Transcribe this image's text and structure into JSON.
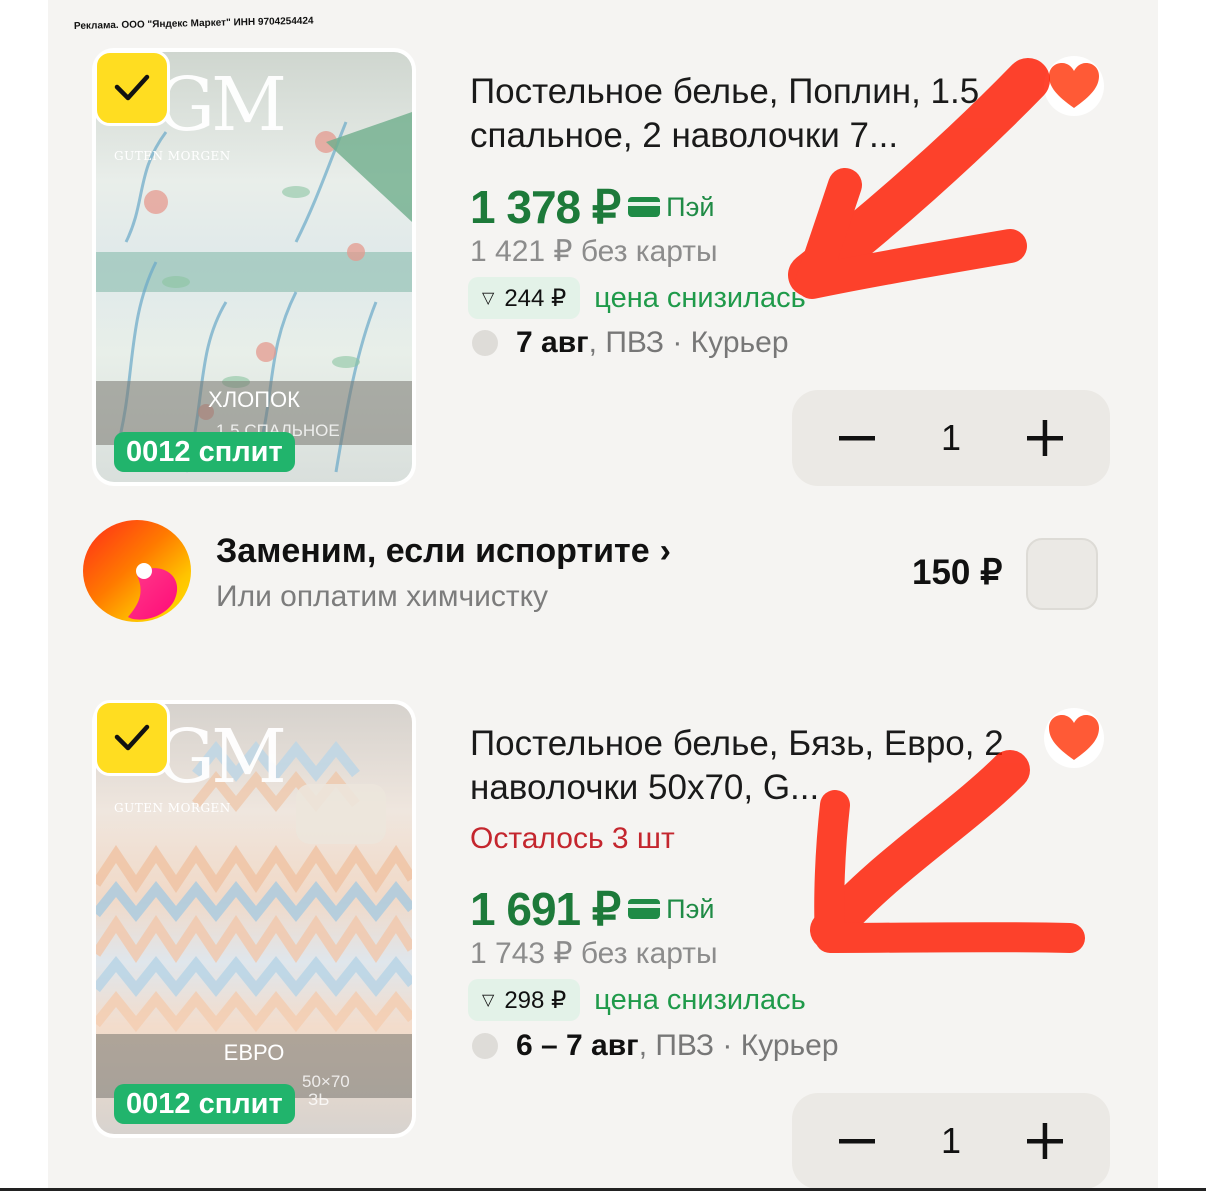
{
  "ad_label": "Реклама. ООО \"Яндекс Маркет\" ИНН 9704254424",
  "products": [
    {
      "brand_mono": "GM",
      "brand_name": "GUTEN MORGEN",
      "image_band_text": "ХЛОПОК",
      "image_band_small": "1.5 СПАЛЬНОЕ",
      "split_badge": "0012 сплит",
      "title": "Постельное белье, Поплин, 1.5 спальное, 2 наволочки 7...",
      "stock": "",
      "price": "1 378 ₽",
      "pay_label": "Пэй",
      "old_price": "1 421 ₽  без карты",
      "price_drop": "244 ₽",
      "price_drop_label": "цена снизилась",
      "delivery_date": "7 авг",
      "delivery_rest": ", ПВЗ · Курьер",
      "quantity": "1",
      "favorite": true
    },
    {
      "brand_mono": "GM",
      "brand_name": "GUTEN MORGEN",
      "image_band_text": "ЕВРО",
      "image_band_small": "50×70",
      "image_band_small2": "ЗЬ",
      "split_badge": "0012 сплит",
      "title": "Постельное белье, Бязь, Евро, 2 наволочки 50x70, G...",
      "stock": "Осталось 3 шт",
      "price": "1 691 ₽",
      "pay_label": "Пэй",
      "old_price": "1 743 ₽  без карты",
      "price_drop": "298 ₽",
      "price_drop_label": "цена снизилась",
      "delivery_date": "6 – 7 авг",
      "delivery_rest": ", ПВЗ · Курьер",
      "quantity": "1",
      "favorite": true
    }
  ],
  "service": {
    "title": "Заменим, если испортите",
    "subtitle": "Или оплатим химчистку",
    "price": "150 ₽",
    "checked": false
  },
  "icons": {
    "check": "check-icon",
    "minus": "minus-icon",
    "plus": "plus-icon",
    "heart": "heart-icon",
    "chevron": "chevron-right-icon",
    "card": "card-icon",
    "triangle": "triangle-down-icon"
  },
  "colors": {
    "price_green": "#1d7a3a",
    "split_green": "#21b46c",
    "yandex_yellow": "#ffdd21",
    "heart_orange": "#ff5a36",
    "stock_red": "#c4262e",
    "annotation_red": "#ff1a00"
  }
}
